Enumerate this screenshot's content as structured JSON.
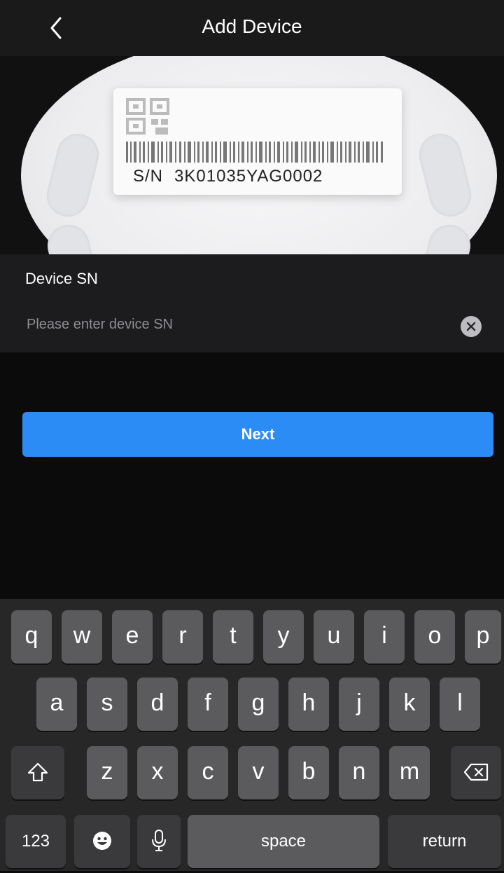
{
  "header": {
    "title": "Add Device"
  },
  "hero": {
    "sn_prefix": "S/N",
    "sn_value": "3K01035YAG0002"
  },
  "form": {
    "label": "Device SN",
    "placeholder": "Please enter device SN",
    "value": ""
  },
  "actions": {
    "next_label": "Next"
  },
  "keyboard": {
    "row1": [
      "q",
      "w",
      "e",
      "r",
      "t",
      "y",
      "u",
      "i",
      "o",
      "p"
    ],
    "row2": [
      "a",
      "s",
      "d",
      "f",
      "g",
      "h",
      "j",
      "k",
      "l"
    ],
    "row3": [
      "z",
      "x",
      "c",
      "v",
      "b",
      "n",
      "m"
    ],
    "numbers_label": "123",
    "space_label": "space",
    "return_label": "return"
  },
  "colors": {
    "accent": "#2c8cf5",
    "background": "#0b0b0b",
    "panel": "#1c1c1e"
  }
}
